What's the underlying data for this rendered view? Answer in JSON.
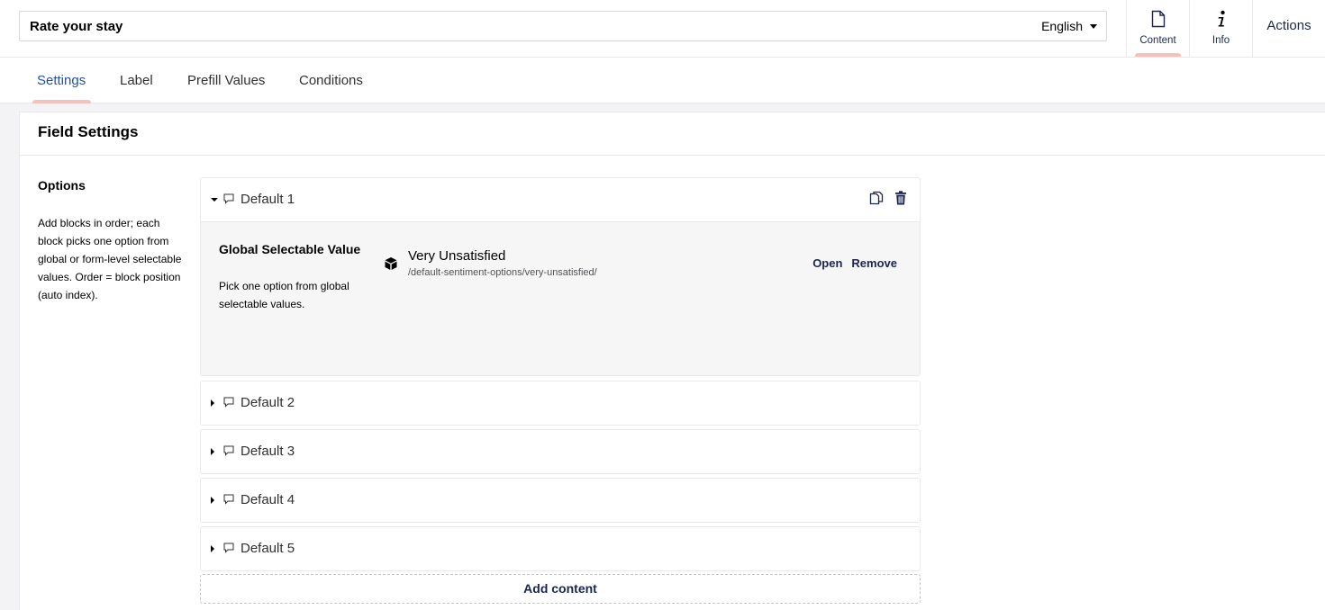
{
  "header": {
    "name_value": "Rate your stay",
    "language": "English",
    "apps": [
      {
        "label": "Content",
        "icon": "document-icon",
        "active": true
      },
      {
        "label": "Info",
        "icon": "info-icon",
        "active": false
      }
    ],
    "actions_label": "Actions"
  },
  "tabs": [
    {
      "label": "Settings",
      "active": true
    },
    {
      "label": "Label",
      "active": false
    },
    {
      "label": "Prefill Values",
      "active": false
    },
    {
      "label": "Conditions",
      "active": false
    }
  ],
  "panel": {
    "title": "Field Settings",
    "property": {
      "label": "Options",
      "description": "Add blocks in order; each block picks one option from global or form-level selectable values. Order = block position (auto index)."
    },
    "blocks": [
      {
        "name": "Default 1",
        "expanded": true,
        "content": {
          "label": "Global Selectable Value",
          "description": "Pick one option from global selectable values.",
          "picked_name": "Very Unsatisfied",
          "picked_path": "/default-sentiment-options/very-unsatisfied/",
          "open_label": "Open",
          "remove_label": "Remove"
        }
      },
      {
        "name": "Default 2",
        "expanded": false
      },
      {
        "name": "Default 3",
        "expanded": false
      },
      {
        "name": "Default 4",
        "expanded": false
      },
      {
        "name": "Default 5",
        "expanded": false
      }
    ],
    "add_content_label": "Add content"
  },
  "colors": {
    "accent_underline": "#f5c1bc",
    "active_tab": "#2152a3",
    "text_dark": "#1b264f"
  }
}
